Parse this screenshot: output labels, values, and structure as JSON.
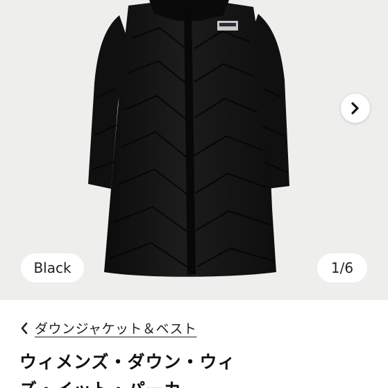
{
  "gallery": {
    "color_name": "Black",
    "counter": "1/6",
    "next_icon": "chevron-right-icon"
  },
  "breadcrumb": {
    "label": "ダウンジャケット＆ベスト",
    "icon": "chevron-left-icon"
  },
  "product": {
    "title": "ウィメンズ・ダウン・ウィズ・イット・パーカ"
  },
  "colors": {
    "gallery_bg": "#eeeeec",
    "jacket": "#141414",
    "text": "#222222"
  }
}
